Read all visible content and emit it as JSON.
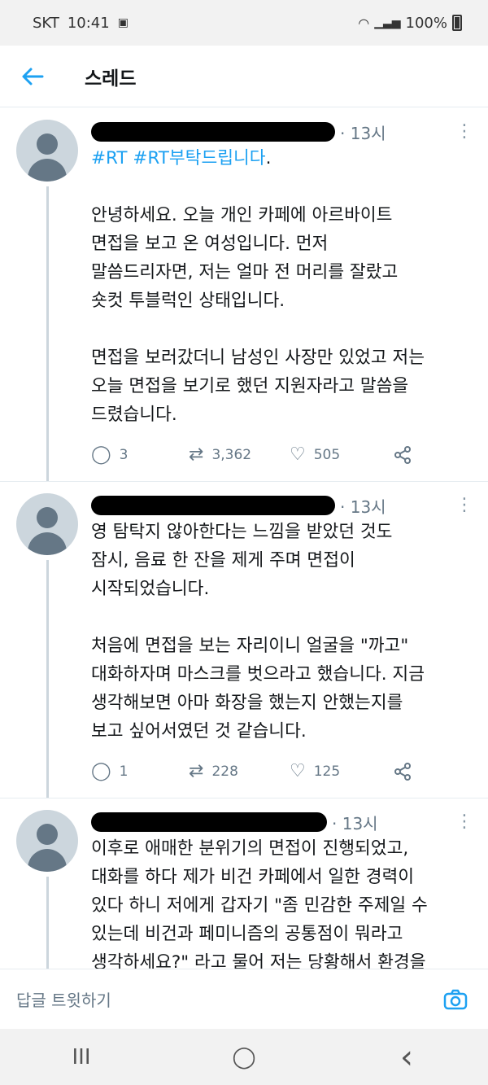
{
  "status_bar": {
    "carrier": "SKT",
    "time": "10:41",
    "signal_text": "📶",
    "battery": "100%"
  },
  "header": {
    "back_icon": "arrow-left-icon",
    "title": "스레드"
  },
  "tweets": [
    {
      "time": "· 13시",
      "text_hashtags": "#RT #RT부탁드립니다",
      "text_after_hashtags": ".",
      "text": "\n\n안녕하세요. 오늘 개인 카페에 아르바이트\n면접을 보고 온 여성입니다. 먼저\n말씀드리자면, 저는 얼마 전 머리를 잘랐고\n숏컷 투블럭인 상태입니다.\n\n면접을 보러갔더니 남성인 사장만 있었고 저는\n오늘 면접을 보기로 했던 지원자라고 말씀을\n드렸습니다.",
      "replies": "3",
      "retweets": "3,362",
      "likes": "505"
    },
    {
      "time": "· 13시",
      "text": "영 탐탁지 않아한다는 느낌을 받았던 것도\n잠시, 음료 한 잔을 제게 주며 면접이\n시작되었습니다.\n\n처음에 면접을 보는 자리이니 얼굴을 \"까고\"\n대화하자며 마스크를 벗으라고 했습니다. 지금\n생각해보면 아마 화장을 했는지 안했는지를\n보고 싶어서였던 것 같습니다.",
      "replies": "1",
      "retweets": "228",
      "likes": "125"
    },
    {
      "time": "· 13시",
      "text": "이후로 애매한 분위기의 면접이 진행되었고,\n대화를 하다 제가 비건 카페에서 일한 경력이\n있다 하니 저에게 갑자기 \"좀 민감한 주제일 수\n있는데 비건과 페미니즘의 공통점이 뭐라고\n생각하세요?\" 라고 물어 저는 당황해서 환경을\n생각하고 더 나은 세상을 위해 움직이는\n것이라고 말했습니다."
    }
  ],
  "reply_bar": {
    "placeholder": "답글 트윗하기"
  },
  "nav": {
    "recent": "III",
    "home": "◯",
    "back": "‹"
  }
}
